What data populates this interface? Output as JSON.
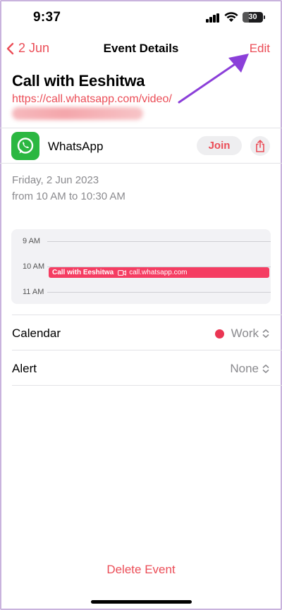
{
  "status": {
    "time": "9:37",
    "battery": "30"
  },
  "nav": {
    "back_label": "2 Jun",
    "title": "Event Details",
    "edit_label": "Edit"
  },
  "event": {
    "title": "Call with Eeshitwa",
    "url": "https://call.whatsapp.com/video/"
  },
  "app": {
    "name": "WhatsApp",
    "join_label": "Join"
  },
  "when": {
    "date": "Friday, 2 Jun 2023",
    "time_range": "from 10 AM to 10:30 AM"
  },
  "timeline": {
    "hours": [
      "9 AM",
      "10 AM",
      "11 AM"
    ],
    "event_title": "Call with Eeshitwa",
    "event_location": "call.whatsapp.com"
  },
  "settings": {
    "calendar": {
      "label": "Calendar",
      "value": "Work",
      "color": "#ea3553"
    },
    "alert": {
      "label": "Alert",
      "value": "None"
    }
  },
  "actions": {
    "delete_label": "Delete Event"
  },
  "colors": {
    "accent": "#eb4d57",
    "whatsapp": "#2bb741",
    "annotation_arrow": "#8b3fd9"
  }
}
